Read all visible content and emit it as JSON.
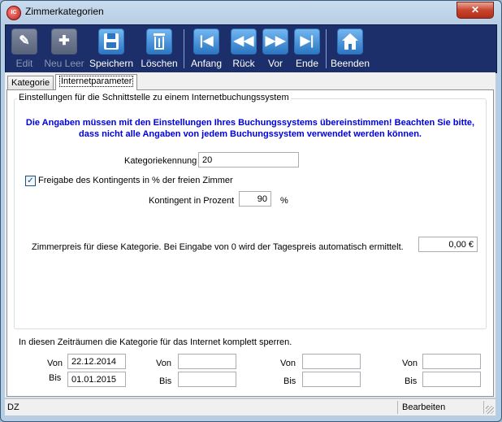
{
  "window": {
    "title": "Zimmerkategorien"
  },
  "toolbar": {
    "edit": "Edit",
    "neu_leer": "Neu Leer",
    "speichern": "Speichern",
    "loeschen": "Löschen",
    "anfang": "Anfang",
    "rueck": "Rück",
    "vor": "Vor",
    "ende": "Ende",
    "beenden": "Beenden"
  },
  "tabs": {
    "kategorie": "Kategorie",
    "internetparameter": "Internetparameter"
  },
  "group": {
    "title": "Einstellungen für die Schnittstelle zu einem Internetbuchungssystem",
    "warning_line1": "Die Angaben müssen mit den Einstellungen Ihres Buchungssystems übereinstimmen! Beachten Sie bitte,",
    "warning_line2": "dass nicht alle Angaben von jedem Buchungssystem verwendet werden können.",
    "kategoriekennung_label": "Kategoriekennung",
    "kategoriekennung_value": "20",
    "freigabe_label": "Freigabe des Kontingents in % der freien Zimmer",
    "freigabe_checked": "✓",
    "kontingent_label": "Kontingent in Prozent",
    "kontingent_value": "90",
    "kontingent_unit": "%",
    "zimmerpreis_label": "Zimmerpreis für diese Kategorie. Bei Eingabe von 0 wird der Tagespreis automatisch ermittelt.",
    "zimmerpreis_value": "0,00 €"
  },
  "sperren": {
    "title": "In diesen Zeiträumen die Kategorie für das Internet komplett sperren.",
    "von_label": "Von",
    "bis_label": "Bis",
    "periods": [
      {
        "von": "22.12.2014",
        "bis": "01.01.2015"
      },
      {
        "von": "",
        "bis": ""
      },
      {
        "von": "",
        "bis": ""
      },
      {
        "von": "",
        "bis": ""
      }
    ]
  },
  "status": {
    "left": "DZ",
    "right": "Bearbeiten"
  }
}
